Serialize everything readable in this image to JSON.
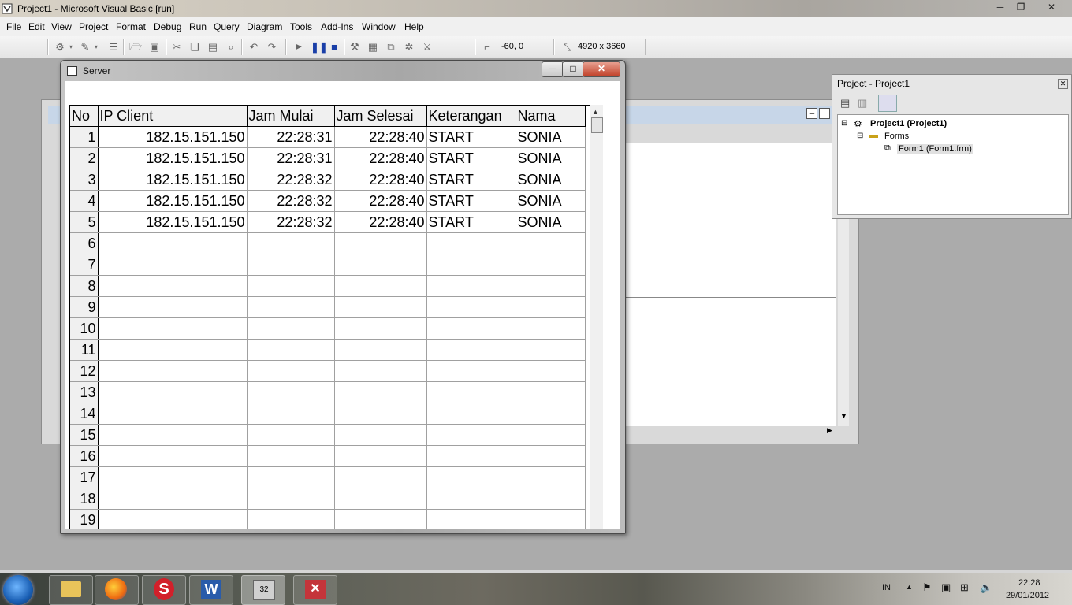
{
  "app": {
    "title": "Project1 - Microsoft Visual Basic [run]",
    "caption_buttons": {
      "minimize": "─",
      "restore": "❐",
      "close": "✕"
    }
  },
  "menu": [
    "File",
    "Edit",
    "View",
    "Project",
    "Format",
    "Debug",
    "Run",
    "Query",
    "Diagram",
    "Tools",
    "Add-Ins",
    "Window",
    "Help"
  ],
  "toolbar": {
    "position": "-60, 0",
    "size": "4920 x 3660"
  },
  "server_window": {
    "title": "Server",
    "close_glyph": "✕",
    "min_glyph": "─",
    "max_glyph": "□",
    "grid": {
      "headers": [
        "No",
        "IP Client",
        "Jam Mulai",
        "Jam Selesai",
        "Keterangan",
        "Nama"
      ],
      "rows": [
        [
          "1",
          "182.15.151.150",
          "22:28:31",
          "22:28:40",
          "START",
          "SONIA"
        ],
        [
          "2",
          "182.15.151.150",
          "22:28:31",
          "22:28:40",
          "START",
          "SONIA"
        ],
        [
          "3",
          "182.15.151.150",
          "22:28:32",
          "22:28:40",
          "START",
          "SONIA"
        ],
        [
          "4",
          "182.15.151.150",
          "22:28:32",
          "22:28:40",
          "START",
          "SONIA"
        ],
        [
          "5",
          "182.15.151.150",
          "22:28:32",
          "22:28:40",
          "START",
          "SONIA"
        ],
        [
          "6",
          "",
          "",
          "",
          "",
          ""
        ],
        [
          "7",
          "",
          "",
          "",
          "",
          ""
        ],
        [
          "8",
          "",
          "",
          "",
          "",
          ""
        ],
        [
          "9",
          "",
          "",
          "",
          "",
          ""
        ],
        [
          "10",
          "",
          "",
          "",
          "",
          ""
        ],
        [
          "11",
          "",
          "",
          "",
          "",
          ""
        ],
        [
          "12",
          "",
          "",
          "",
          "",
          ""
        ],
        [
          "13",
          "",
          "",
          "",
          "",
          ""
        ],
        [
          "14",
          "",
          "",
          "",
          "",
          ""
        ],
        [
          "15",
          "",
          "",
          "",
          "",
          ""
        ],
        [
          "16",
          "",
          "",
          "",
          "",
          ""
        ],
        [
          "17",
          "",
          "",
          "",
          "",
          ""
        ],
        [
          "18",
          "",
          "",
          "",
          "",
          ""
        ],
        [
          "19",
          "",
          "",
          "",
          "",
          ""
        ]
      ]
    }
  },
  "project_explorer": {
    "title": "Project - Project1",
    "close_glyph": "✕",
    "project_node": "Project1 (Project1)",
    "forms_node": "Forms",
    "form_node": "Form1 (Form1.frm)"
  },
  "taskbar": {
    "language": "IN",
    "time": "22:28",
    "date": "29/01/2012",
    "apps": [
      "explorer-icon",
      "firefox-icon",
      "app-icon",
      "word-icon",
      "vb6-icon",
      "app2-icon"
    ]
  }
}
